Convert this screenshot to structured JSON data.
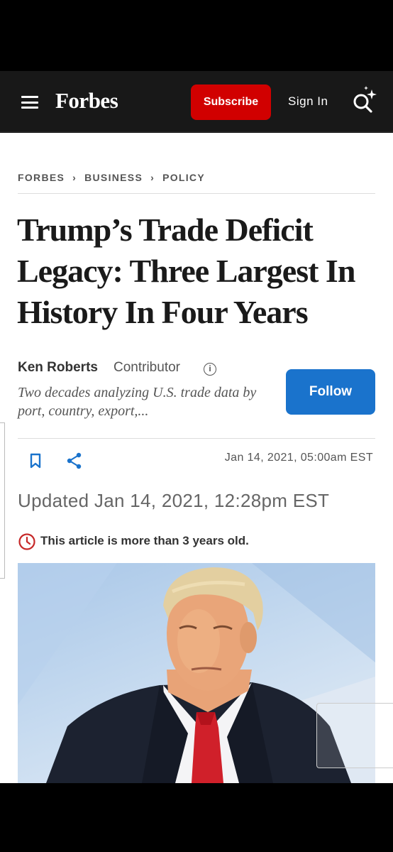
{
  "header": {
    "logo": "Forbes",
    "subscribe_label": "Subscribe",
    "signin_label": "Sign In"
  },
  "breadcrumb": [
    "FORBES",
    "BUSINESS",
    "POLICY"
  ],
  "article": {
    "headline": "Trump’s Trade Deficit Legacy: Three Largest In History In Four Years",
    "author_name": "Ken Roberts",
    "author_role": "Contributor",
    "author_bio": "Two decades analyzing U.S. trade data by port, country, export,...",
    "follow_label": "Follow",
    "published": "Jan 14, 2021, 05:00am EST",
    "updated": "Updated Jan 14, 2021, 12:28pm EST",
    "age_notice": "This article is more than 3 years old."
  },
  "colors": {
    "subscribe": "#d10000",
    "follow": "#1a73cc",
    "action_icons": "#1a73cc",
    "notice_icon": "#c62828"
  },
  "icons": [
    "menu-icon",
    "search-sparkle-icon",
    "chevron-right-icon",
    "info-icon",
    "bookmark-icon",
    "share-icon",
    "clock-icon"
  ]
}
